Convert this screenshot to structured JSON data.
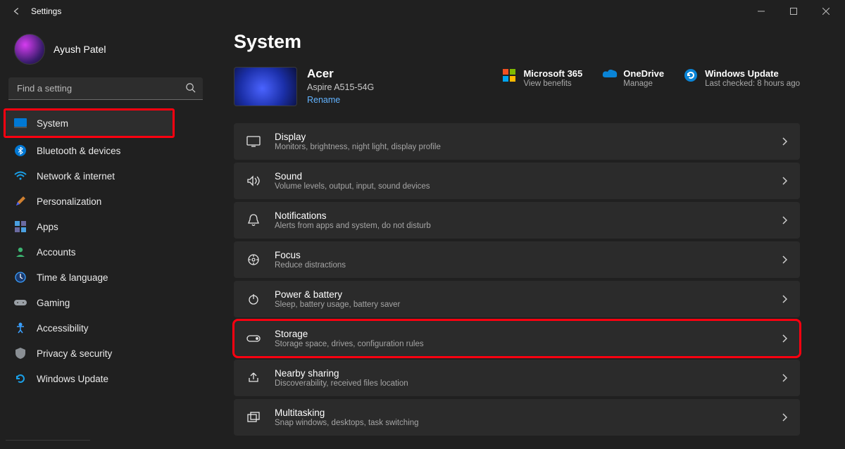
{
  "app": {
    "title": "Settings"
  },
  "profile": {
    "name": "Ayush Patel"
  },
  "search": {
    "placeholder": "Find a setting"
  },
  "nav": [
    {
      "label": "System"
    },
    {
      "label": "Bluetooth & devices"
    },
    {
      "label": "Network & internet"
    },
    {
      "label": "Personalization"
    },
    {
      "label": "Apps"
    },
    {
      "label": "Accounts"
    },
    {
      "label": "Time & language"
    },
    {
      "label": "Gaming"
    },
    {
      "label": "Accessibility"
    },
    {
      "label": "Privacy & security"
    },
    {
      "label": "Windows Update"
    }
  ],
  "page": {
    "title": "System",
    "device": {
      "name": "Acer",
      "model": "Aspire A515-54G",
      "rename": "Rename"
    },
    "toplinks": {
      "ms365": {
        "title": "Microsoft 365",
        "subtitle": "View benefits"
      },
      "onedrive": {
        "title": "OneDrive",
        "subtitle": "Manage"
      },
      "winupdate": {
        "title": "Windows Update",
        "subtitle": "Last checked: 8 hours ago"
      }
    },
    "cards": [
      {
        "title": "Display",
        "subtitle": "Monitors, brightness, night light, display profile"
      },
      {
        "title": "Sound",
        "subtitle": "Volume levels, output, input, sound devices"
      },
      {
        "title": "Notifications",
        "subtitle": "Alerts from apps and system, do not disturb"
      },
      {
        "title": "Focus",
        "subtitle": "Reduce distractions"
      },
      {
        "title": "Power & battery",
        "subtitle": "Sleep, battery usage, battery saver"
      },
      {
        "title": "Storage",
        "subtitle": "Storage space, drives, configuration rules"
      },
      {
        "title": "Nearby sharing",
        "subtitle": "Discoverability, received files location"
      },
      {
        "title": "Multitasking",
        "subtitle": "Snap windows, desktops, task switching"
      }
    ]
  }
}
